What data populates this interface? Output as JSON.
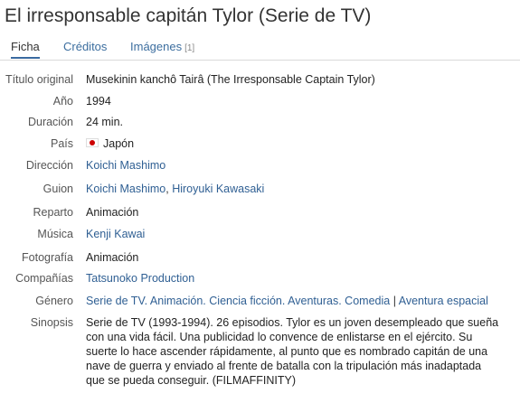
{
  "title": "El irresponsable capitán Tylor (Serie de TV)",
  "tabs": {
    "ficha": "Ficha",
    "creditos": "Créditos",
    "imagenes": "Imágenes",
    "imagenes_count": "[1]"
  },
  "details": {
    "titulo_original": {
      "label": "Título original",
      "value": "Musekinin kanchô Tairâ (The Irresponsable Captain Tylor)"
    },
    "anio": {
      "label": "Año",
      "value": "1994"
    },
    "duracion": {
      "label": "Duración",
      "value": "24 min."
    },
    "pais": {
      "label": "País",
      "value": "Japón",
      "flag_icon": "japan-flag-icon"
    },
    "direccion": {
      "label": "Dirección",
      "links": [
        "Koichi Mashimo"
      ]
    },
    "guion": {
      "label": "Guion",
      "links": [
        "Koichi Mashimo",
        "Hiroyuki Kawasaki"
      ],
      "separator": ","
    },
    "reparto": {
      "label": "Reparto",
      "value": "Animación"
    },
    "musica": {
      "label": "Música",
      "links": [
        "Kenji Kawai"
      ]
    },
    "fotografia": {
      "label": "Fotografía",
      "value": "Animación"
    },
    "companias": {
      "label": "Compañías",
      "links": [
        "Tatsunoko Production"
      ]
    },
    "genero": {
      "label": "Género",
      "links": [
        "Serie de TV",
        "Animación",
        "Ciencia ficción",
        "Aventuras",
        "Comedia",
        "Aventura espacial"
      ],
      "dot": ".",
      "bar": "|"
    },
    "sinopsis": {
      "label": "Sinopsis",
      "lines": [
        "Serie de TV (1993-1994). 26 episodios. Tylor es un joven desempleado que sueña",
        "con una vida fácil. Una publicidad lo convence de enlistarse en el ejército. Su",
        "suerte lo hace ascender rápidamente, al punto que es nombrado capitán de una",
        "nave de guerra y enviado al frente de batalla con la tripulación más inadaptada",
        "que se pueda conseguir. (FILMAFFINITY)"
      ]
    }
  },
  "colors": {
    "link": "#2f5f93",
    "label": "#555555",
    "flag_red": "#cc0000"
  }
}
